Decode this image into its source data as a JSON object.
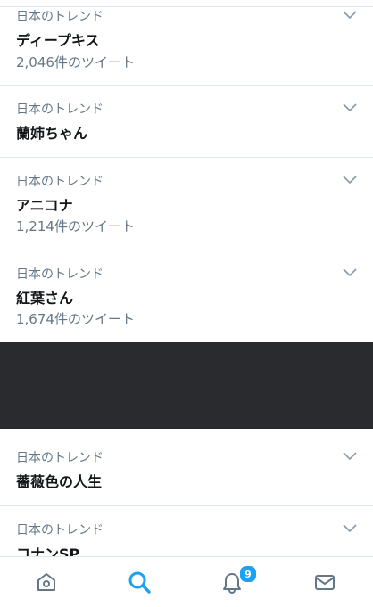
{
  "trends": [
    {
      "context": "日本のトレンド",
      "name": "ディープキス",
      "count": "2,046件のツイート"
    },
    {
      "context": "日本のトレンド",
      "name": "蘭姉ちゃん",
      "count": ""
    },
    {
      "context": "日本のトレンド",
      "name": "アニコナ",
      "count": "1,214件のツイート"
    },
    {
      "context": "日本のトレンド",
      "name": "紅葉さん",
      "count": "1,674件のツイート"
    },
    {
      "context": "日本のトレンド",
      "name": "薔薇色の人生",
      "count": ""
    },
    {
      "context": "日本のトレンド",
      "name": "コナンSP",
      "count": ""
    }
  ],
  "tabbar": {
    "active_color": "#1da1f2",
    "inactive_color": "#657786",
    "notifications_badge": "9",
    "icons": [
      "home-icon",
      "search-icon",
      "bell-icon",
      "mail-icon"
    ]
  }
}
